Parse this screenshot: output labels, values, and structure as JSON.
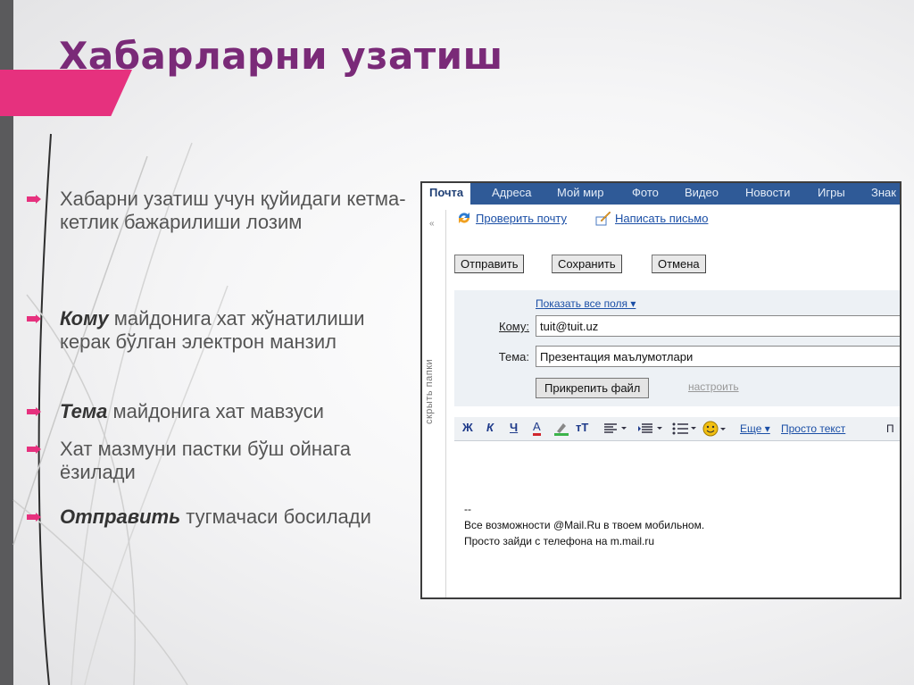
{
  "slide": {
    "title": "Хабарларни узатиш",
    "bullets": [
      {
        "pre": "",
        "bold": "",
        "post": "Хабарни узатиш учун қуйидаги кетма-кетлик бажарилиши лозим"
      },
      {
        "pre": "",
        "bold": "Кому",
        "post": " майдонига хат жўнатилиши керак бўлган электрон манзил"
      },
      {
        "pre": "",
        "bold": "Тема",
        "post": " майдонига хат мавзуси"
      },
      {
        "pre": "",
        "bold": "",
        "post": "Хат мазмуни пастки бўш ойнага ёзилади"
      },
      {
        "pre": "",
        "bold": "Отправить",
        "post": " тугмачаси босилади"
      }
    ],
    "colors": {
      "accent": "#e6317e",
      "title": "#7a2a78",
      "side_bar": "#5a5a5c"
    }
  },
  "mail": {
    "tabs": [
      "Почта",
      "Адреса",
      "Мой мир",
      "Фото",
      "Видео",
      "Новости",
      "Игры",
      "Знак"
    ],
    "side_label": "скрыть папки",
    "side_arrow": "«",
    "links": {
      "check": "Проверить почту",
      "compose": "Написать письмо"
    },
    "buttons": {
      "send": "Отправить",
      "save": "Сохранить",
      "cancel": "Отмена"
    },
    "show_all": "Показать все поля ▾",
    "to_label": "Кому:",
    "to_value": "tuit@tuit.uz",
    "subject_label": "Тема:",
    "subject_value": "Презентация маълумотлари",
    "attach": "Прикрепить файл",
    "setup": "настроить",
    "toolbar": {
      "bold": "Ж",
      "italic": "К",
      "underline": "Ч",
      "color": "А",
      "size": "тТ",
      "more": "Еще ▾",
      "plain": "Просто текст",
      "cut": "П"
    },
    "signature": [
      "--",
      "Все возможности @Mail.Ru в твоем мобильном.",
      "Просто зайди с телефона на m.mail.ru"
    ]
  }
}
